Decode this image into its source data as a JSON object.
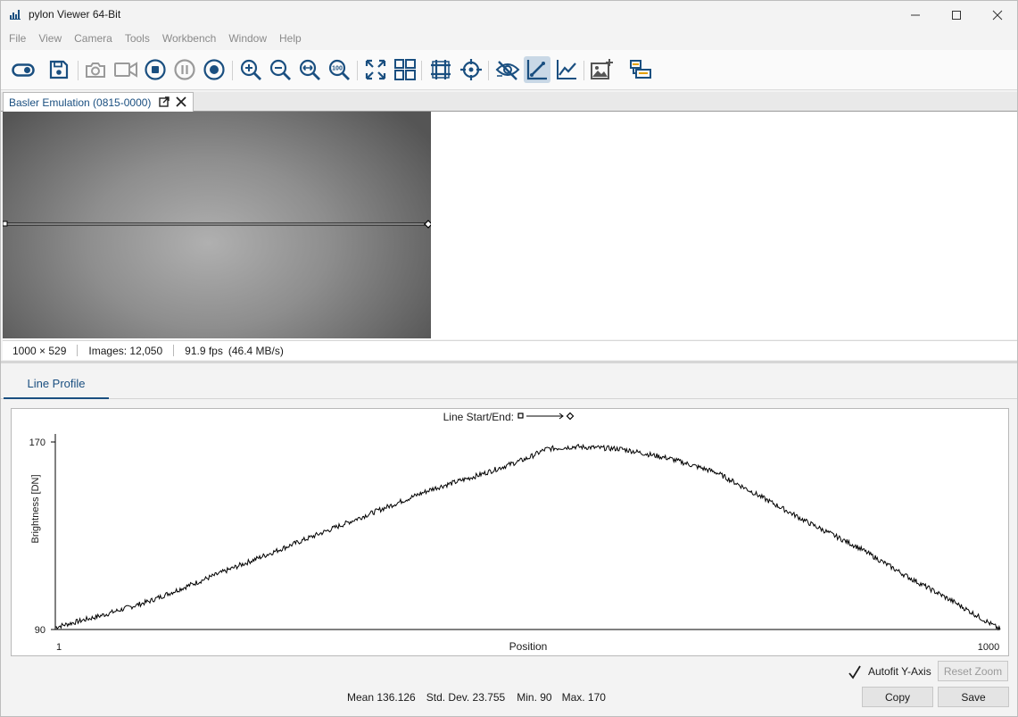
{
  "window": {
    "title": "pylon Viewer 64-Bit"
  },
  "menu": [
    "File",
    "View",
    "Camera",
    "Tools",
    "Workbench",
    "Window",
    "Help"
  ],
  "toolbar": {
    "icons": [
      "toggle-icon",
      "save-icon",
      "camera-snapshot-icon",
      "video-icon",
      "stop-icon",
      "pause-icon",
      "record-icon",
      "zoom-in-icon",
      "zoom-out-icon",
      "zoom-fit-icon",
      "zoom-100-icon",
      "fullscreen-icon",
      "tile-view-icon",
      "grid-overlay-icon",
      "crosshair-icon",
      "hide-overlay-icon",
      "line-profile-icon",
      "histogram-icon",
      "add-image-icon",
      "feature-panel-icon"
    ],
    "active_tool": "line-profile-icon",
    "zoom_100_text": "100"
  },
  "document_tab": {
    "label": "Basler Emulation (0815-0000)"
  },
  "image_status": {
    "resolution": "1000 × 529",
    "images": "Images: 12,050",
    "fps": "91.9 fps",
    "throughput": "(46.4 MB/s)"
  },
  "line_profile": {
    "tab_label": "Line Profile",
    "header_label": "Line Start/End:",
    "autofit_label": "Autofit Y-Axis",
    "autofit_checked": true,
    "reset_zoom_label": "Reset Zoom",
    "copy_label": "Copy",
    "save_label": "Save",
    "stats": {
      "mean": "Mean 136.126",
      "std_dev": "Std. Dev. 23.755",
      "min": "Min. 90",
      "max": "Max. 170"
    }
  },
  "chart_data": {
    "type": "line",
    "xlabel": "Position",
    "ylabel": "Brightness [DN]",
    "xlim": [
      1,
      1000
    ],
    "ylim": [
      90,
      170
    ],
    "x_ticks": [
      "1",
      "1000"
    ],
    "y_ticks": [
      "170",
      "90"
    ],
    "grid": false,
    "series": [
      {
        "x": [
          1,
          50,
          100,
          150,
          200,
          250,
          300,
          350,
          400,
          450,
          500,
          520,
          550,
          600,
          650,
          700,
          750,
          800,
          850,
          900,
          950,
          1000
        ],
        "values": [
          91,
          96,
          102,
          110,
          118,
          126,
          134,
          142,
          150,
          156,
          163,
          167,
          168,
          167,
          163,
          157,
          146,
          135,
          125,
          113,
          102,
          90
        ]
      }
    ]
  }
}
